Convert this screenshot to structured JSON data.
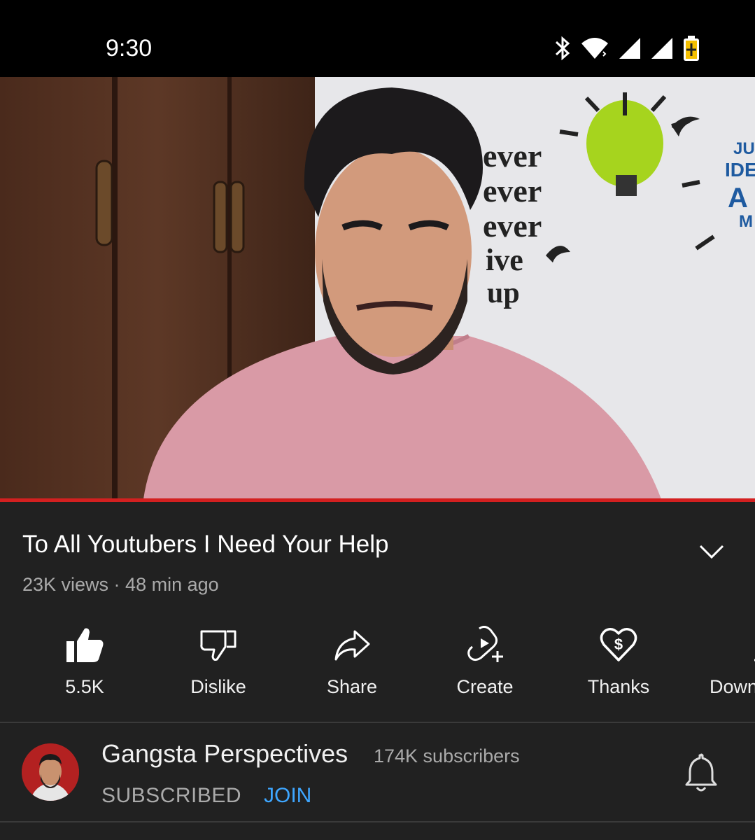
{
  "status_bar": {
    "time": "9:30",
    "icons": [
      "bluetooth-icon",
      "wifi-icon",
      "signal-icon",
      "signal-icon",
      "battery-charging-icon"
    ]
  },
  "video": {
    "progress": 1.0,
    "progress_color": "#d32020",
    "wall_text": [
      "ever",
      "ever",
      "ever",
      "ive",
      "up",
      "JU",
      "IDE",
      "A",
      "M"
    ]
  },
  "details": {
    "title": "To All Youtubers I Need Your Help",
    "meta": "23K views · 48 min ago"
  },
  "actions": [
    {
      "icon": "thumbs-up-filled-icon",
      "label": "5.5K"
    },
    {
      "icon": "thumbs-down-icon",
      "label": "Dislike"
    },
    {
      "icon": "share-icon",
      "label": "Share"
    },
    {
      "icon": "create-icon",
      "label": "Create"
    },
    {
      "icon": "thanks-icon",
      "label": "Thanks"
    },
    {
      "icon": "download-icon",
      "label": "Down"
    }
  ],
  "channel": {
    "name": "Gangsta Perspectives",
    "subscribers": "174K subscribers",
    "subscribed_label": "SUBSCRIBED",
    "join_label": "JOIN",
    "join_color": "#3ea6ff"
  }
}
